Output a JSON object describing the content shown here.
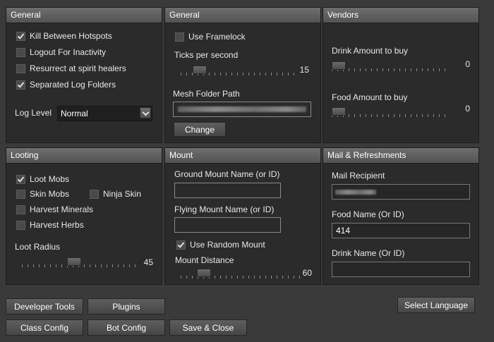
{
  "general_left": {
    "header": "General",
    "checkboxes": [
      {
        "label": "Kill Between Hotspots",
        "checked": true
      },
      {
        "label": "Logout For Inactivity",
        "checked": false
      },
      {
        "label": "Resurrect at spirit healers",
        "checked": false
      },
      {
        "label": "Separated Log Folders",
        "checked": true
      }
    ],
    "log_level_label": "Log Level",
    "log_level_value": "Normal"
  },
  "general_mid": {
    "header": "General",
    "use_framelock": {
      "label": "Use Framelock",
      "checked": false
    },
    "ticks_label": "Ticks per second",
    "ticks_value": "15",
    "ticks_fraction": 0.12,
    "mesh_label": "Mesh Folder Path",
    "change_button": "Change"
  },
  "vendors": {
    "header": "Vendors",
    "drink_label": "Drink Amount to buy",
    "drink_value": "0",
    "drink_fraction": 0.0,
    "food_label": "Food Amount to buy",
    "food_value": "0",
    "food_fraction": 0.0
  },
  "looting": {
    "header": "Looting",
    "loot_mobs": {
      "label": "Loot Mobs",
      "checked": true
    },
    "skin_mobs": {
      "label": "Skin Mobs",
      "checked": false
    },
    "ninja_skin": {
      "label": "Ninja Skin",
      "checked": false
    },
    "harvest_minerals": {
      "label": "Harvest Minerals",
      "checked": false
    },
    "harvest_herbs": {
      "label": "Harvest Herbs",
      "checked": false
    },
    "radius_label": "Loot Radius",
    "radius_value": "45",
    "radius_fraction": 0.45
  },
  "mount": {
    "header": "Mount",
    "ground_label": "Ground Mount Name (or ID)",
    "ground_value": "",
    "flying_label": "Flying Mount Name (or ID)",
    "flying_value": "",
    "random_mount": {
      "label": "Use Random Mount",
      "checked": true
    },
    "distance_label": "Mount Distance",
    "distance_value": "60",
    "distance_fraction": 0.15
  },
  "mail": {
    "header": "Mail & Refreshments",
    "recipient_label": "Mail Recipient",
    "food_label": "Food Name (Or ID)",
    "food_value": "414",
    "drink_label": "Drink Name (Or ID)",
    "drink_value": ""
  },
  "buttons": {
    "developer_tools": "Developer Tools",
    "plugins": "Plugins",
    "class_config": "Class Config",
    "bot_config": "Bot Config",
    "save_close": "Save & Close",
    "select_language": "Select Language"
  }
}
